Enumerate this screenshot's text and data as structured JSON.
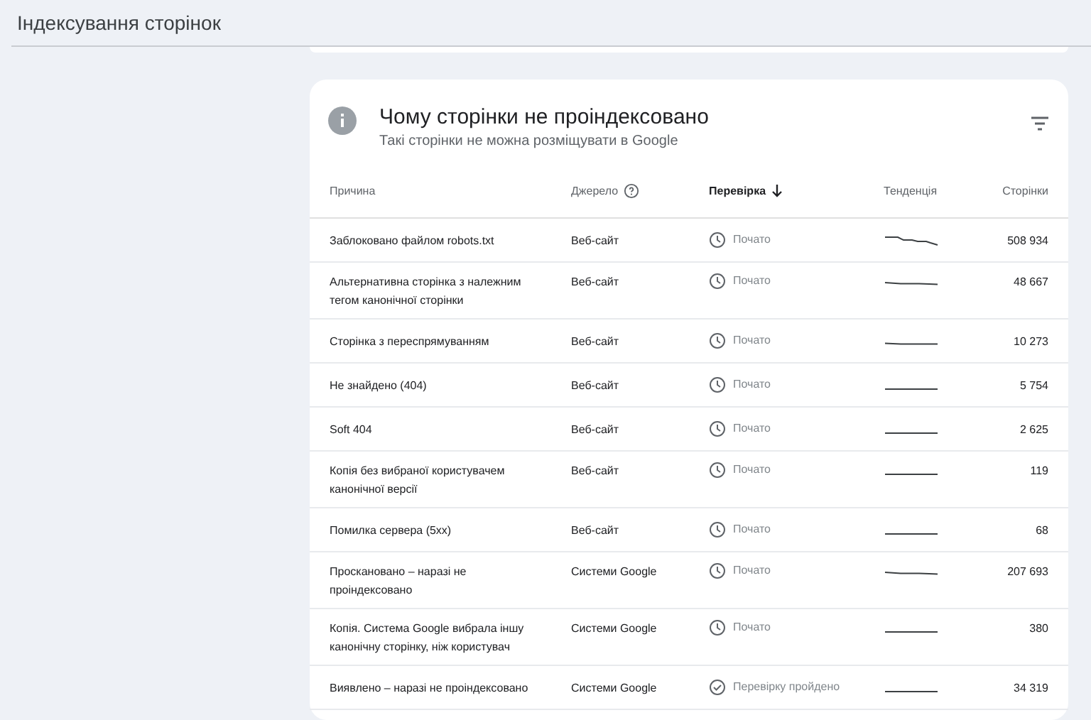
{
  "page": {
    "title": "Індексування сторінок"
  },
  "card": {
    "title": "Чому сторінки не проіндексовано",
    "subtitle": "Такі сторінки не можна розміщувати в Google"
  },
  "table": {
    "columns": [
      {
        "label": "Причина",
        "kind": "plain"
      },
      {
        "label": "Джерело",
        "kind": "help"
      },
      {
        "label": "Перевірка",
        "kind": "sorted"
      },
      {
        "label": "Тенденція",
        "kind": "plain"
      },
      {
        "label": "Сторінки",
        "kind": "plain"
      }
    ],
    "rows": [
      {
        "reason": "Заблоковано файлом robots.txt",
        "source": "Веб-сайт",
        "check": {
          "kind": "started",
          "label": "Почато"
        },
        "pages": "508 934"
      },
      {
        "reason": "Альтернативна сторінка з належним тегом канонічної сторінки",
        "source": "Веб-сайт",
        "check": {
          "kind": "started",
          "label": "Почато"
        },
        "pages": "48 667"
      },
      {
        "reason": "Сторінка з переспрямуванням",
        "source": "Веб-сайт",
        "check": {
          "kind": "started",
          "label": "Почато"
        },
        "pages": "10 273"
      },
      {
        "reason": "Не знайдено (404)",
        "source": "Веб-сайт",
        "check": {
          "kind": "started",
          "label": "Почато"
        },
        "pages": "5 754"
      },
      {
        "reason": "Soft 404",
        "source": "Веб-сайт",
        "check": {
          "kind": "started",
          "label": "Почато"
        },
        "pages": "2 625"
      },
      {
        "reason": "Копія без вибраної користувачем канонічної версії",
        "source": "Веб-сайт",
        "check": {
          "kind": "started",
          "label": "Почато"
        },
        "pages": "119"
      },
      {
        "reason": "Помилка сервера (5xx)",
        "source": "Веб-сайт",
        "check": {
          "kind": "started",
          "label": "Почато"
        },
        "pages": "68"
      },
      {
        "reason": "Проскановано – наразі не проіндексовано",
        "source": "Системи Google",
        "check": {
          "kind": "started",
          "label": "Почато"
        },
        "pages": "207 693"
      },
      {
        "reason": "Копія. Система Google вибрала іншу канонічну сторінку, ніж користувач",
        "source": "Системи Google",
        "check": {
          "kind": "started",
          "label": "Почато"
        },
        "pages": "380"
      },
      {
        "reason": "Виявлено – наразі не проіндексовано",
        "source": "Системи Google",
        "check": {
          "kind": "passed",
          "label": "Перевірку пройдено"
        },
        "pages": "34 319"
      }
    ]
  }
}
